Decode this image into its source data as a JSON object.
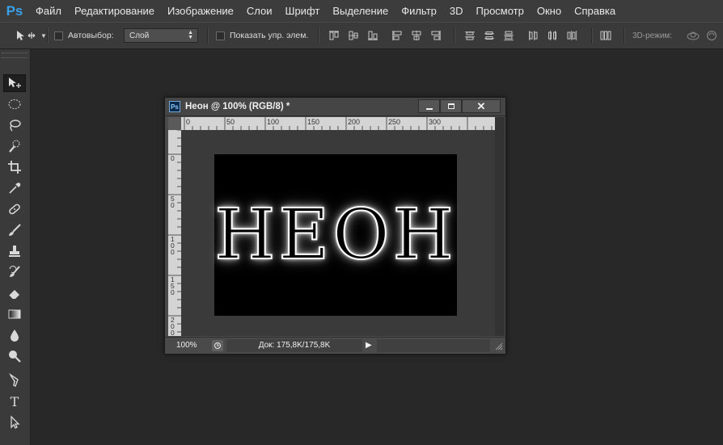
{
  "app": {
    "logo": "Ps"
  },
  "menu": [
    "Файл",
    "Редактирование",
    "Изображение",
    "Слои",
    "Шрифт",
    "Выделение",
    "Фильтр",
    "3D",
    "Просмотр",
    "Окно",
    "Справка"
  ],
  "options": {
    "auto_select_label": "Автовыбор:",
    "auto_select_value": "Слой",
    "show_transform_label": "Показать упр. элем.",
    "mode_3d_label": "3D-режим:"
  },
  "tools": [
    "move-tool",
    "marquee-tool",
    "lasso-tool",
    "quick-select-tool",
    "crop-tool",
    "eyedropper-tool",
    "healing-brush-tool",
    "brush-tool",
    "clone-stamp-tool",
    "history-brush-tool",
    "eraser-tool",
    "gradient-tool",
    "blur-tool",
    "dodge-tool",
    "pen-tool",
    "type-tool",
    "path-select-tool"
  ],
  "document": {
    "title": "Неон @ 100% (RGB/8) *",
    "canvas_text": "HEOH",
    "zoom": "100%",
    "doc_size": "Док: 175,8K/175,8K",
    "ruler_h_labels": [
      "0",
      "50",
      "100",
      "150",
      "200",
      "250",
      "300"
    ],
    "ruler_v_labels": [
      "0",
      "5\n0",
      "1\n0\n0",
      "1\n5\n0",
      "2\n0\n0"
    ]
  },
  "colors": {
    "workspace": "#282828",
    "panel": "#3a3a3a",
    "accent": "#3aa0e8"
  }
}
